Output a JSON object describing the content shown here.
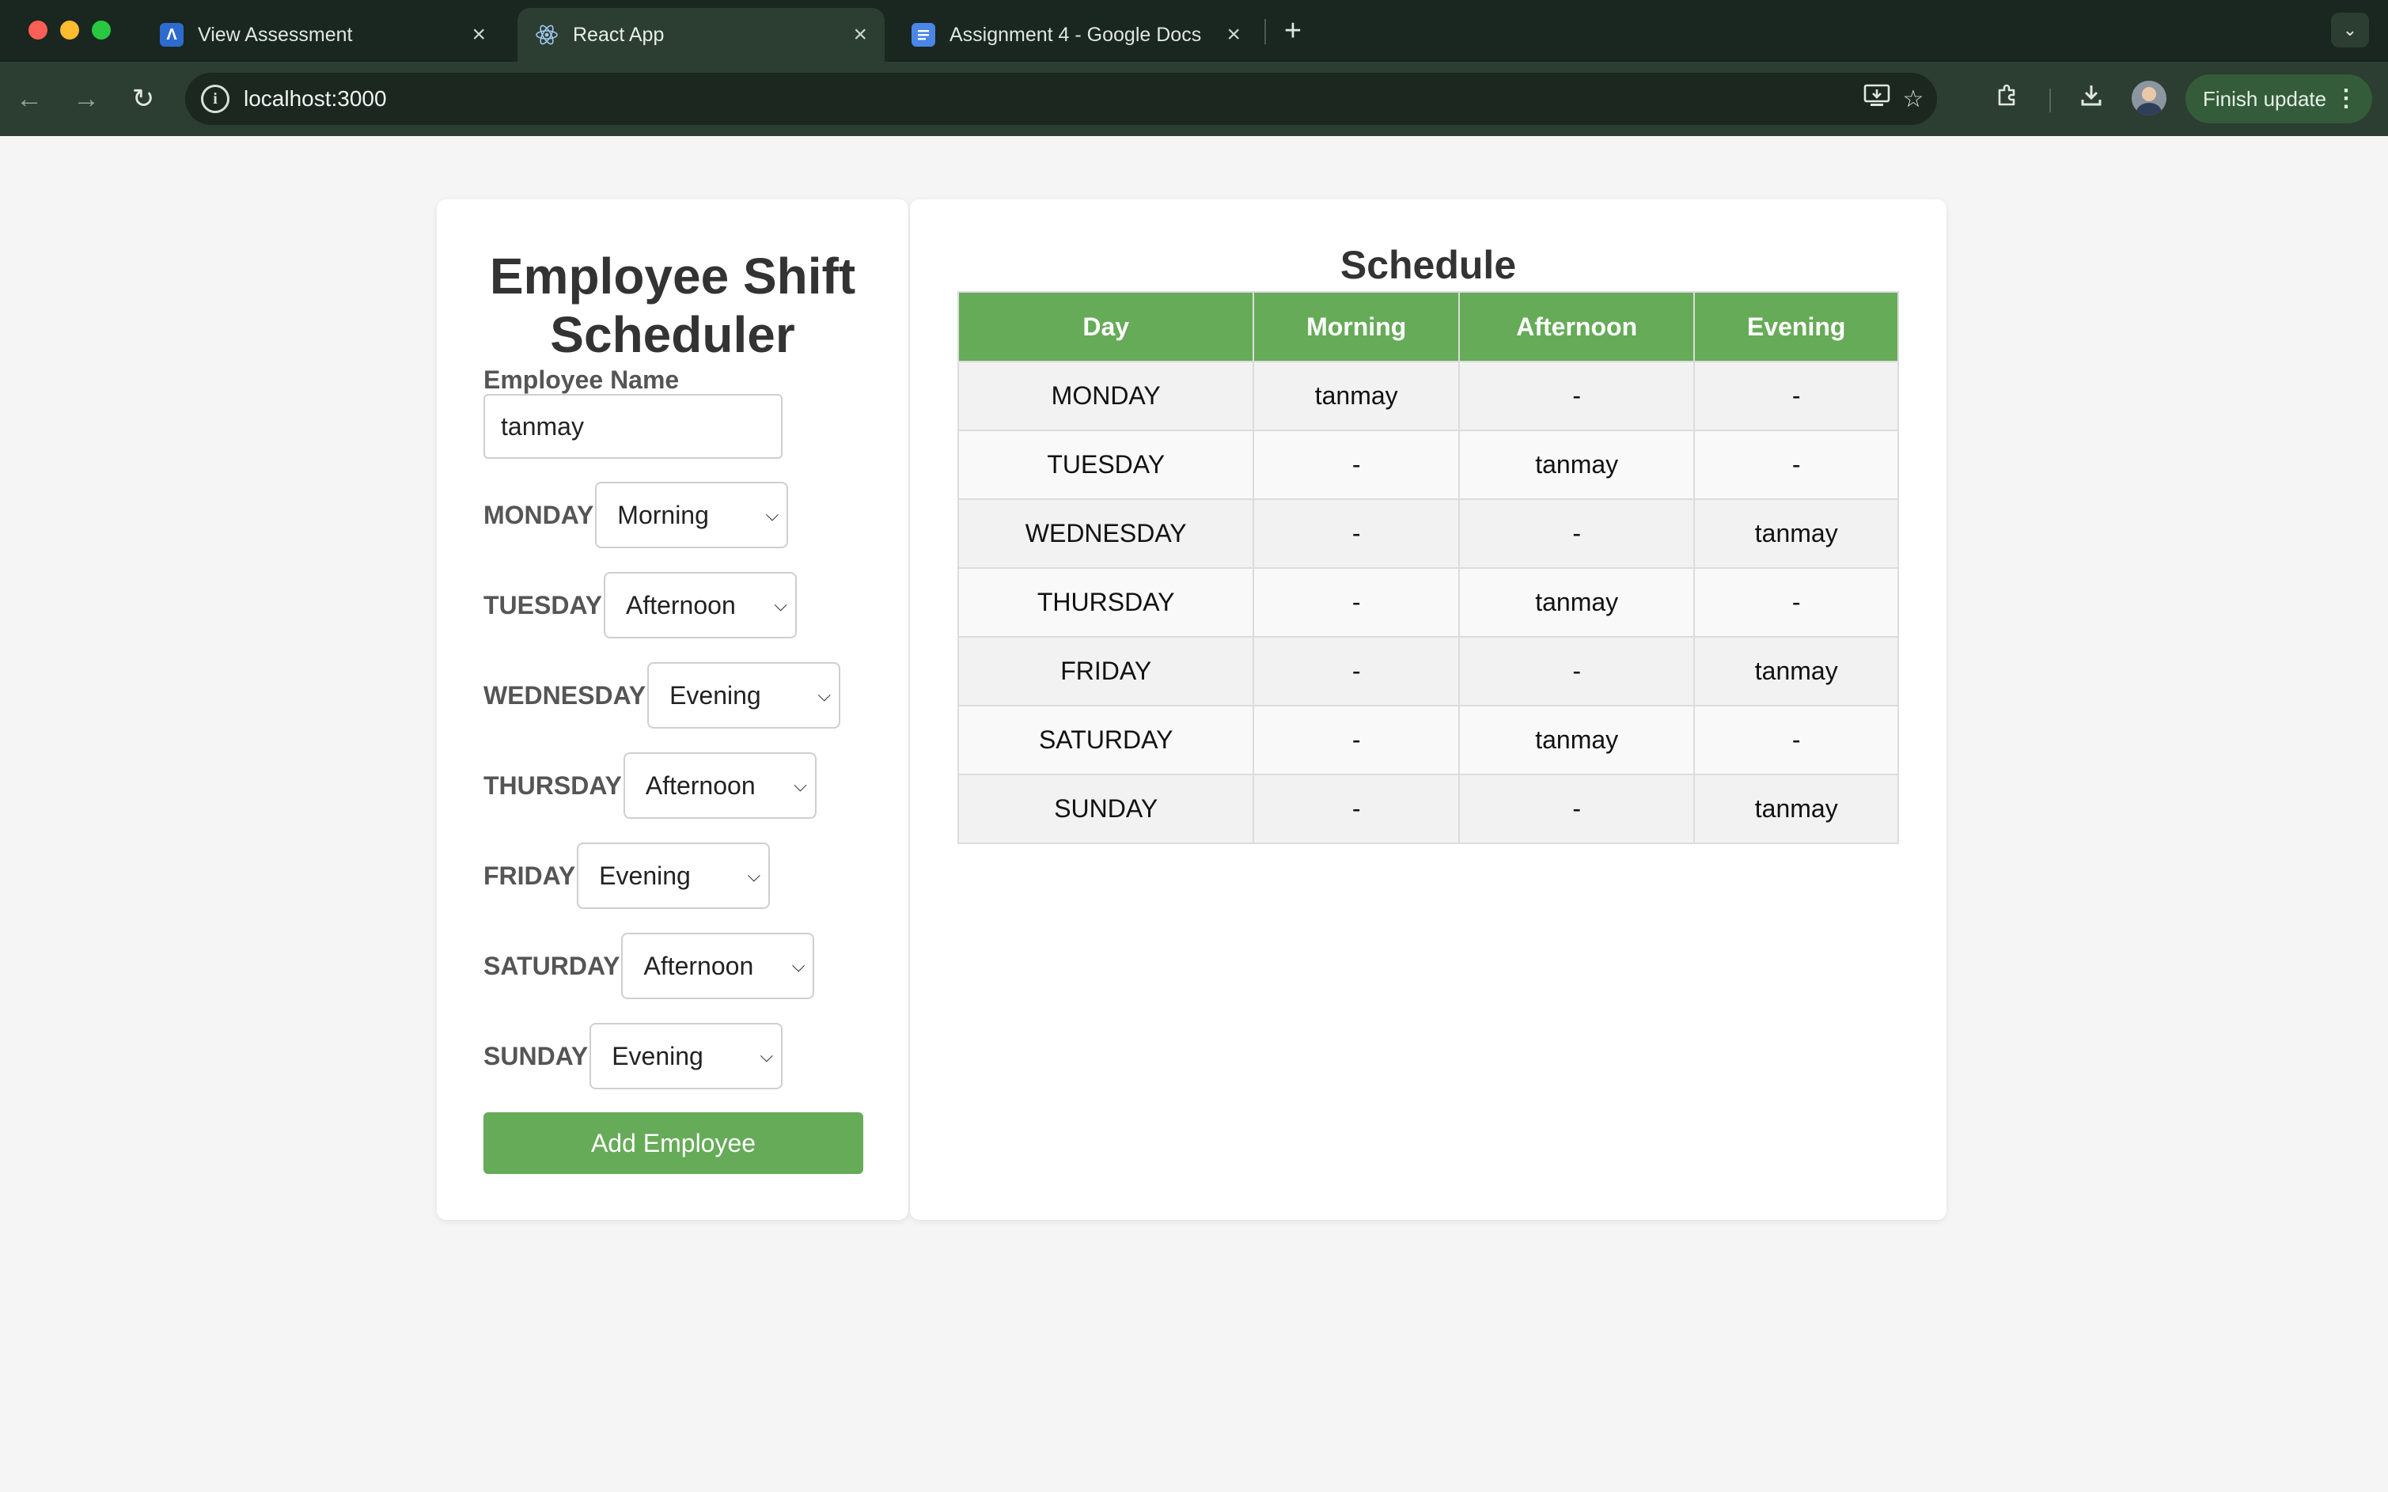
{
  "browser": {
    "tabs": [
      {
        "title": "View Assessment",
        "favicon": "assessment-favicon",
        "color": "#2d6bcf"
      },
      {
        "title": "React App",
        "favicon": "react-favicon",
        "color": "#61dafb"
      },
      {
        "title": "Assignment 4 - Google Docs",
        "favicon": "google-docs-favicon",
        "color": "#4a86e8"
      }
    ],
    "url": "localhost:3000",
    "finish_update": "Finish update"
  },
  "form": {
    "title": "Employee Shift Scheduler",
    "name_label": "Employee Name",
    "name_value": "tanmay",
    "days": [
      {
        "day": "MONDAY",
        "shift": "Morning"
      },
      {
        "day": "TUESDAY",
        "shift": "Afternoon"
      },
      {
        "day": "WEDNESDAY",
        "shift": "Evening"
      },
      {
        "day": "THURSDAY",
        "shift": "Afternoon"
      },
      {
        "day": "FRIDAY",
        "shift": "Evening"
      },
      {
        "day": "SATURDAY",
        "shift": "Afternoon"
      },
      {
        "day": "SUNDAY",
        "shift": "Evening"
      }
    ],
    "add_button": "Add Employee"
  },
  "schedule": {
    "title": "Schedule",
    "headers": [
      "Day",
      "Morning",
      "Afternoon",
      "Evening"
    ],
    "rows": [
      [
        "MONDAY",
        "tanmay",
        "-",
        "-"
      ],
      [
        "TUESDAY",
        "-",
        "tanmay",
        "-"
      ],
      [
        "WEDNESDAY",
        "-",
        "-",
        "tanmay"
      ],
      [
        "THURSDAY",
        "-",
        "tanmay",
        "-"
      ],
      [
        "FRIDAY",
        "-",
        "-",
        "tanmay"
      ],
      [
        "SATURDAY",
        "-",
        "tanmay",
        "-"
      ],
      [
        "SUNDAY",
        "-",
        "-",
        "tanmay"
      ]
    ]
  },
  "colors": {
    "accent_green": "#66ab58",
    "chrome_bg": "#2c3d31"
  }
}
